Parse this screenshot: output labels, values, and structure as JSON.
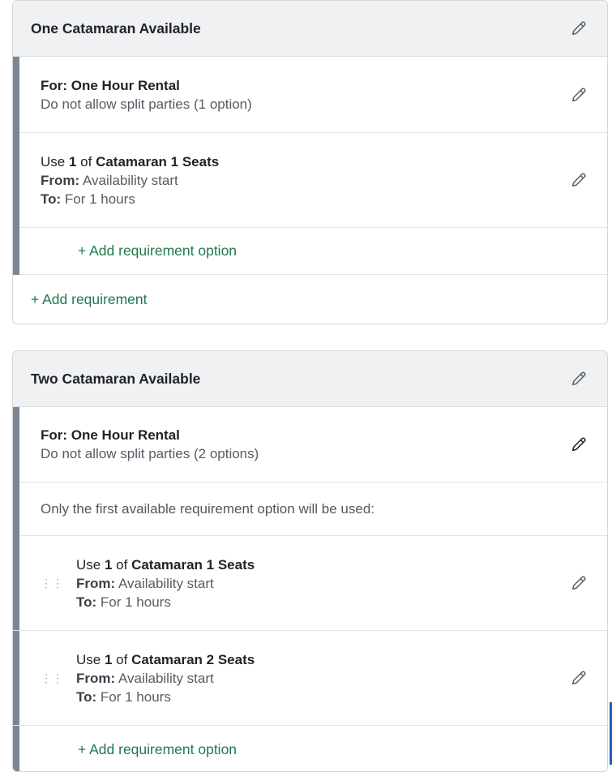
{
  "colors": {
    "accent_green": "#1e7a4d",
    "bar_gray": "#7b8695",
    "header_bg": "#f0f1f2"
  },
  "icons": {
    "edit": "pencil-icon",
    "drag": "drag-handle-icon"
  },
  "cards": [
    {
      "title": "One Catamaran Available",
      "requirement": {
        "for_label": "For: One Hour Rental",
        "split_note": "Do not allow split parties (1 option)"
      },
      "options": [
        {
          "use_prefix": "Use ",
          "qty": "1",
          "of_text": " of ",
          "resource": "Catamaran 1 Seats",
          "from_label": "From:",
          "from_value": " Availability start",
          "to_label": "To:",
          "to_value": " For 1 hours"
        }
      ],
      "add_option_label": "+ Add requirement option",
      "add_requirement_label": "+ Add requirement"
    },
    {
      "title": "Two Catamaran Available",
      "requirement": {
        "for_label": "For: One Hour Rental",
        "split_note": "Do not allow split parties (2 options)"
      },
      "note": "Only the first available requirement option will be used:",
      "options": [
        {
          "use_prefix": "Use ",
          "qty": "1",
          "of_text": " of ",
          "resource": "Catamaran 1 Seats",
          "from_label": "From:",
          "from_value": " Availability start",
          "to_label": "To:",
          "to_value": " For 1 hours"
        },
        {
          "use_prefix": "Use ",
          "qty": "1",
          "of_text": " of ",
          "resource": "Catamaran 2 Seats",
          "from_label": "From:",
          "from_value": " Availability start",
          "to_label": "To:",
          "to_value": " For 1 hours"
        }
      ],
      "add_option_label": "+ Add requirement option"
    }
  ]
}
